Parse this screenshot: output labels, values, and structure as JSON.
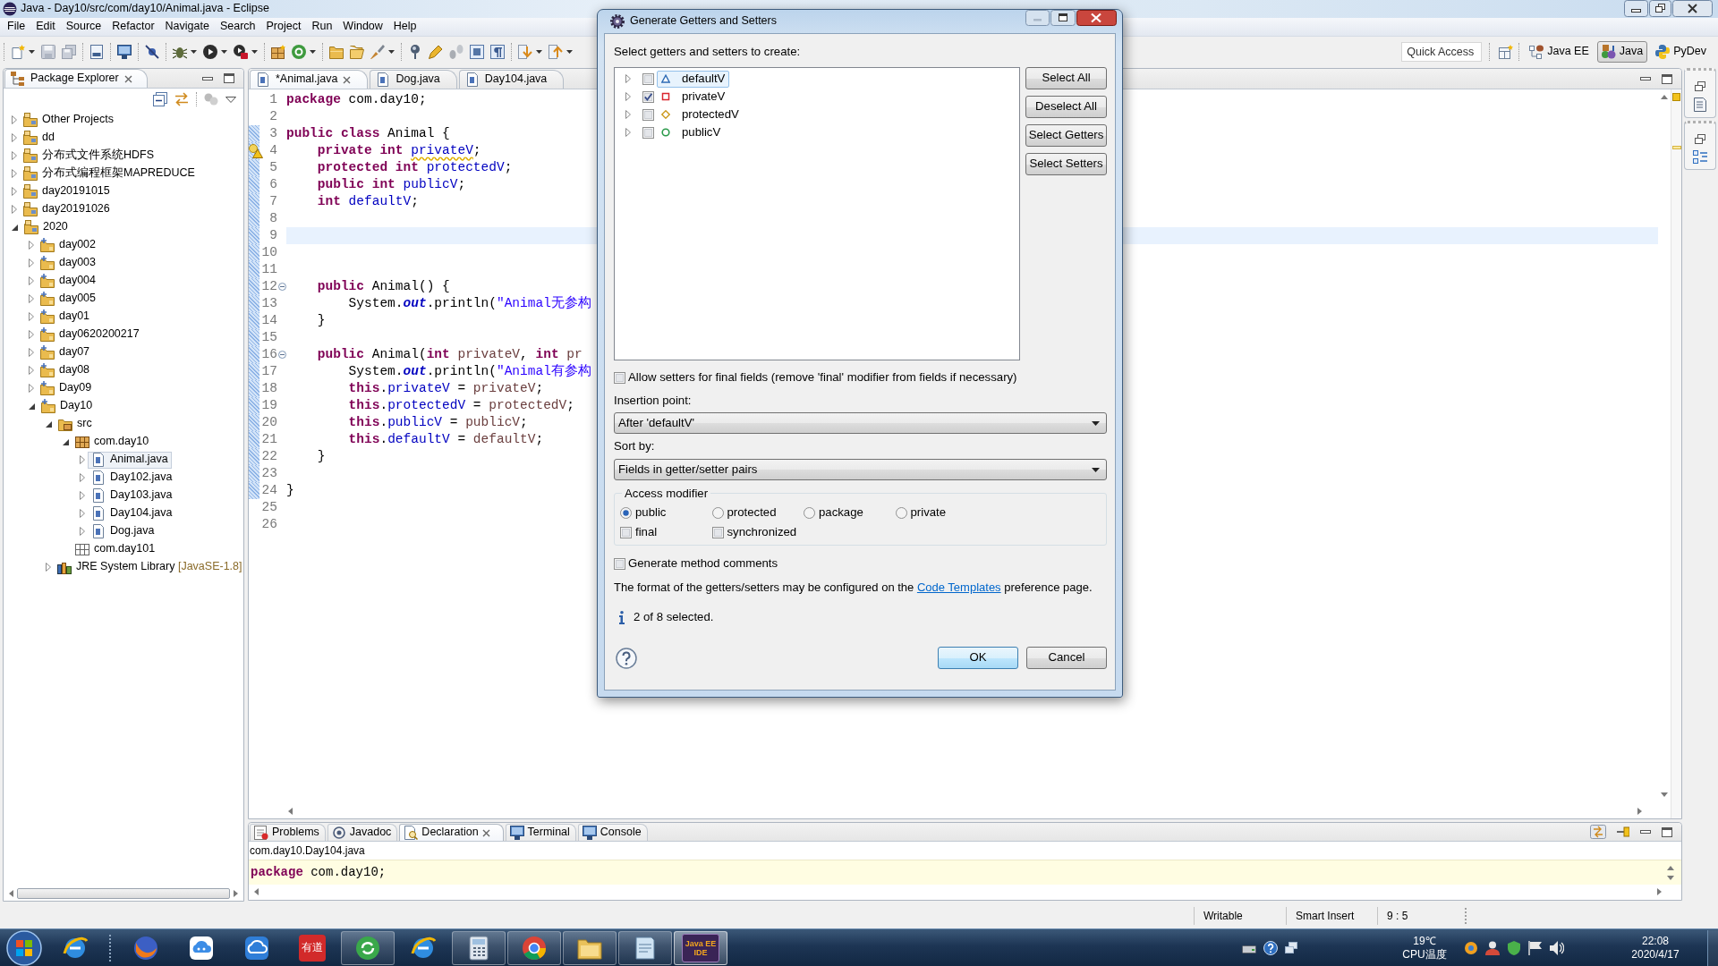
{
  "window": {
    "title": "Java - Day10/src/com/day10/Animal.java - Eclipse"
  },
  "menu": [
    "File",
    "Edit",
    "Source",
    "Refactor",
    "Navigate",
    "Search",
    "Project",
    "Run",
    "Window",
    "Help"
  ],
  "toolbar": {
    "quick_access": {
      "placeholder": "Quick Access"
    },
    "perspectives": [
      {
        "label": "Java EE",
        "selected": false
      },
      {
        "label": "Java",
        "selected": true
      },
      {
        "label": "PyDev",
        "selected": false
      }
    ]
  },
  "package_explorer": {
    "title": "Package Explorer",
    "tree": [
      {
        "label": "Other Projects",
        "kind": "working_set",
        "expanded": false,
        "selected": false
      },
      {
        "label": "dd",
        "kind": "working_set",
        "expanded": false,
        "selected": false
      },
      {
        "label": "分布式文件系统HDFS",
        "kind": "working_set",
        "expanded": false,
        "selected": false
      },
      {
        "label": "分布式编程框架MAPREDUCE",
        "kind": "working_set",
        "expanded": false,
        "selected": false
      },
      {
        "label": "day20191015",
        "kind": "working_set",
        "expanded": false,
        "selected": false
      },
      {
        "label": "day20191026",
        "kind": "working_set",
        "expanded": false,
        "selected": false
      },
      {
        "label": "2020",
        "kind": "working_set",
        "expanded": true,
        "selected": false,
        "children": [
          {
            "label": "day002",
            "kind": "project",
            "expanded": false,
            "selected": false
          },
          {
            "label": "day003",
            "kind": "project",
            "expanded": false,
            "selected": false
          },
          {
            "label": "day004",
            "kind": "project",
            "expanded": false,
            "selected": false
          },
          {
            "label": "day005",
            "kind": "project",
            "expanded": false,
            "selected": false
          },
          {
            "label": "day01",
            "kind": "project",
            "expanded": false,
            "selected": false
          },
          {
            "label": "day0620200217",
            "kind": "project",
            "expanded": false,
            "selected": false
          },
          {
            "label": "day07",
            "kind": "project",
            "expanded": false,
            "selected": false
          },
          {
            "label": "day08",
            "kind": "project",
            "expanded": false,
            "selected": false
          },
          {
            "label": "Day09",
            "kind": "project",
            "expanded": false,
            "selected": false
          },
          {
            "label": "Day10",
            "kind": "project",
            "expanded": true,
            "selected": false,
            "children": [
              {
                "label": "src",
                "kind": "source_folder",
                "expanded": true,
                "selected": false,
                "children": [
                  {
                    "label": "com.day10",
                    "kind": "package",
                    "expanded": true,
                    "selected": false,
                    "children": [
                      {
                        "label": "Animal.java",
                        "kind": "java_file",
                        "expanded": false,
                        "selected": true
                      },
                      {
                        "label": "Day102.java",
                        "kind": "java_file",
                        "expanded": false,
                        "selected": false
                      },
                      {
                        "label": "Day103.java",
                        "kind": "java_file",
                        "expanded": false,
                        "selected": false
                      },
                      {
                        "label": "Day104.java",
                        "kind": "java_file",
                        "expanded": false,
                        "selected": false
                      },
                      {
                        "label": "Dog.java",
                        "kind": "java_file",
                        "expanded": false,
                        "selected": false
                      }
                    ]
                  },
                  {
                    "label": "com.day101",
                    "kind": "empty_package",
                    "selected": false
                  }
                ]
              },
              {
                "label": "JRE System Library",
                "decoration": "[JavaSE-1.8]",
                "kind": "library",
                "expanded": false,
                "selected": false
              }
            ]
          }
        ]
      }
    ]
  },
  "editor": {
    "tabs": [
      {
        "label": "*Animal.java",
        "selected": true
      },
      {
        "label": "Dog.java",
        "selected": false
      },
      {
        "label": "Day104.java",
        "selected": false
      }
    ],
    "lines": [
      {
        "number": "1",
        "kind": "plain",
        "changed": false,
        "current": false,
        "tokens": [
          {
            "text": "package",
            "kind": "keyword"
          },
          {
            "text": " com.day10;",
            "kind": "plain"
          }
        ]
      },
      {
        "number": "2",
        "kind": "plain",
        "changed": false,
        "current": false
      },
      {
        "number": "3",
        "kind": "plain",
        "changed": true,
        "current": false,
        "tokens": [
          {
            "text": "public class",
            "kind": "keyword"
          },
          {
            "text": " Animal {",
            "kind": "plain"
          }
        ]
      },
      {
        "number": "4",
        "kind": "warning",
        "changed": true,
        "current": false,
        "tokens": [
          {
            "text": "    private int ",
            "kind": "keyword"
          },
          {
            "text": "privateV",
            "kind": "unused_field"
          },
          {
            "text": ";",
            "kind": "plain"
          }
        ]
      },
      {
        "number": "5",
        "kind": "plain",
        "changed": true,
        "current": false,
        "tokens": [
          {
            "text": "    protected int ",
            "kind": "keyword"
          },
          {
            "text": "protectedV",
            "kind": "field"
          },
          {
            "text": ";",
            "kind": "plain"
          }
        ]
      },
      {
        "number": "6",
        "kind": "plain",
        "changed": true,
        "current": false,
        "tokens": [
          {
            "text": "    public int ",
            "kind": "keyword"
          },
          {
            "text": "publicV",
            "kind": "field"
          },
          {
            "text": ";",
            "kind": "plain"
          }
        ]
      },
      {
        "number": "7",
        "kind": "plain",
        "changed": true,
        "current": false,
        "tokens": [
          {
            "text": "    int ",
            "kind": "keyword"
          },
          {
            "text": "defaultV",
            "kind": "field"
          },
          {
            "text": ";",
            "kind": "plain"
          }
        ]
      },
      {
        "number": "8",
        "kind": "plain",
        "changed": true,
        "current": false
      },
      {
        "number": "9",
        "kind": "plain",
        "changed": true,
        "current": true
      },
      {
        "number": "10",
        "kind": "plain",
        "changed": true,
        "current": false
      },
      {
        "number": "11",
        "kind": "plain",
        "changed": true,
        "current": false
      },
      {
        "number": "12",
        "kind": "fold",
        "changed": true,
        "current": false,
        "tokens": [
          {
            "text": "    public",
            "kind": "keyword"
          },
          {
            "text": " Animal() {",
            "kind": "plain"
          }
        ]
      },
      {
        "number": "13",
        "kind": "plain",
        "changed": true,
        "current": false,
        "tokens": [
          {
            "text": "        System.",
            "kind": "plain"
          },
          {
            "text": "out",
            "kind": "static_field"
          },
          {
            "text": ".println(",
            "kind": "plain"
          },
          {
            "text": "\"Animal无参构",
            "kind": "string"
          }
        ]
      },
      {
        "number": "14",
        "kind": "plain",
        "changed": true,
        "current": false,
        "tokens": [
          {
            "text": "    }",
            "kind": "plain"
          }
        ]
      },
      {
        "number": "15",
        "kind": "plain",
        "changed": true,
        "current": false
      },
      {
        "number": "16",
        "kind": "fold",
        "changed": true,
        "current": false,
        "tokens": [
          {
            "text": "    public",
            "kind": "keyword"
          },
          {
            "text": " Animal(",
            "kind": "plain"
          },
          {
            "text": "int",
            "kind": "keyword"
          },
          {
            "text": " privateV",
            "kind": "parameter"
          },
          {
            "text": ", ",
            "kind": "plain"
          },
          {
            "text": "int",
            "kind": "keyword"
          },
          {
            "text": " pr",
            "kind": "parameter"
          }
        ]
      },
      {
        "number": "17",
        "kind": "plain",
        "changed": true,
        "current": false,
        "tokens": [
          {
            "text": "        System.",
            "kind": "plain"
          },
          {
            "text": "out",
            "kind": "static_field"
          },
          {
            "text": ".println(",
            "kind": "plain"
          },
          {
            "text": "\"Animal有参构",
            "kind": "string"
          }
        ]
      },
      {
        "number": "18",
        "kind": "plain",
        "changed": true,
        "current": false,
        "tokens": [
          {
            "text": "        this",
            "kind": "keyword"
          },
          {
            "text": ".",
            "kind": "plain"
          },
          {
            "text": "privateV",
            "kind": "field"
          },
          {
            "text": " = ",
            "kind": "plain"
          },
          {
            "text": "privateV",
            "kind": "parameter"
          },
          {
            "text": ";",
            "kind": "plain"
          }
        ]
      },
      {
        "number": "19",
        "kind": "plain",
        "changed": true,
        "current": false,
        "tokens": [
          {
            "text": "        this",
            "kind": "keyword"
          },
          {
            "text": ".",
            "kind": "plain"
          },
          {
            "text": "protectedV",
            "kind": "field"
          },
          {
            "text": " = ",
            "kind": "plain"
          },
          {
            "text": "protectedV",
            "kind": "parameter"
          },
          {
            "text": ";",
            "kind": "plain"
          }
        ]
      },
      {
        "number": "20",
        "kind": "plain",
        "changed": true,
        "current": false,
        "tokens": [
          {
            "text": "        this",
            "kind": "keyword"
          },
          {
            "text": ".",
            "kind": "plain"
          },
          {
            "text": "publicV",
            "kind": "field"
          },
          {
            "text": " = ",
            "kind": "plain"
          },
          {
            "text": "publicV",
            "kind": "parameter"
          },
          {
            "text": ";",
            "kind": "plain"
          }
        ]
      },
      {
        "number": "21",
        "kind": "plain",
        "changed": true,
        "current": false,
        "tokens": [
          {
            "text": "        this",
            "kind": "keyword"
          },
          {
            "text": ".",
            "kind": "plain"
          },
          {
            "text": "defaultV",
            "kind": "field"
          },
          {
            "text": " = ",
            "kind": "plain"
          },
          {
            "text": "defaultV",
            "kind": "parameter"
          },
          {
            "text": ";",
            "kind": "plain"
          }
        ]
      },
      {
        "number": "22",
        "kind": "plain",
        "changed": true,
        "current": false,
        "tokens": [
          {
            "text": "    }",
            "kind": "plain"
          }
        ]
      },
      {
        "number": "23",
        "kind": "plain",
        "changed": true,
        "current": false
      },
      {
        "number": "24",
        "kind": "plain",
        "changed": true,
        "current": false,
        "tokens": [
          {
            "text": "}",
            "kind": "plain"
          }
        ]
      },
      {
        "number": "25",
        "kind": "plain",
        "changed": false,
        "current": false
      },
      {
        "number": "26",
        "kind": "plain",
        "changed": false,
        "current": false
      }
    ]
  },
  "bottom_panel": {
    "tabs": [
      {
        "label": "Problems",
        "selected": false
      },
      {
        "label": "Javadoc",
        "selected": false
      },
      {
        "label": "Declaration",
        "selected": true
      },
      {
        "label": "Terminal",
        "selected": false
      },
      {
        "label": "Console",
        "selected": false
      }
    ],
    "path": "com.day10.Day104.java",
    "code": [
      {
        "text": "package",
        "kind": "keyword"
      },
      {
        "text": " com.day10;",
        "kind": "plain"
      }
    ]
  },
  "status_bar": [
    "Writable",
    "Smart Insert",
    "9 : 5"
  ],
  "dialog": {
    "title": "Generate Getters and Setters",
    "prompt": "Select getters and setters to create:",
    "fields": [
      {
        "label": "defaultV",
        "kind": "default",
        "expanded": false,
        "checked": false,
        "selected": true
      },
      {
        "label": "privateV",
        "kind": "private",
        "expanded": false,
        "checked": true,
        "selected": false
      },
      {
        "label": "protectedV",
        "kind": "protected",
        "expanded": false,
        "checked": false,
        "selected": false
      },
      {
        "label": "publicV",
        "kind": "public",
        "expanded": false,
        "checked": false,
        "selected": false
      }
    ],
    "side_buttons": [
      "Select All",
      "Deselect All",
      "Select Getters",
      "Select Setters"
    ],
    "allow_final_setters": {
      "label": "Allow setters for final fields (remove 'final' modifier from fields if necessary)",
      "checked": false
    },
    "insertion_point": {
      "label": "Insertion point:",
      "value": "After 'defaultV'"
    },
    "sort_by": {
      "label": "Sort by:",
      "value": "Fields in getter/setter pairs"
    },
    "access_modifier": {
      "title": "Access modifier",
      "options": [
        {
          "label": "public",
          "selected": true
        },
        {
          "label": "protected",
          "selected": false
        },
        {
          "label": "package",
          "selected": false
        },
        {
          "label": "private",
          "selected": false
        }
      ],
      "flags": [
        {
          "label": "final",
          "checked": false
        },
        {
          "label": "synchronized",
          "checked": false
        }
      ]
    },
    "generate_comments": {
      "label": "Generate method comments",
      "checked": false
    },
    "note": {
      "text_before": "The format of the getters/setters may be configured on the",
      "link": "Code Templates",
      "text_after": "preference page."
    },
    "status": "2 of 8 selected.",
    "buttons": [
      {
        "label": "OK",
        "default": true
      },
      {
        "label": "Cancel",
        "default": false
      }
    ]
  },
  "taskbar": {
    "apps": [
      {
        "kind": "e_globe",
        "running": false,
        "selected": false
      },
      {
        "kind": "fox",
        "running": false,
        "selected": false
      },
      {
        "kind": "cloud_face",
        "running": false,
        "selected": false
      },
      {
        "kind": "cloud",
        "running": false,
        "selected": false
      },
      {
        "kind": "text_tile",
        "label": "有道",
        "running": false,
        "selected": false
      },
      {
        "kind": "circle_arrows",
        "running": true,
        "selected": false
      },
      {
        "kind": "e_globe",
        "running": false,
        "selected": false
      },
      {
        "kind": "calculator",
        "running": true,
        "selected": false
      },
      {
        "kind": "wheel",
        "running": true,
        "selected": false
      },
      {
        "kind": "folder",
        "running": true,
        "selected": false
      },
      {
        "kind": "notepad",
        "running": true,
        "selected": false
      },
      {
        "kind": "ide_tile",
        "label": "Java EE IDE",
        "running": true,
        "selected": true
      }
    ],
    "tray": {
      "temperature": "19℃",
      "sensor_label": "CPU温度",
      "time": "22:08",
      "date": "2020/4/17"
    }
  }
}
